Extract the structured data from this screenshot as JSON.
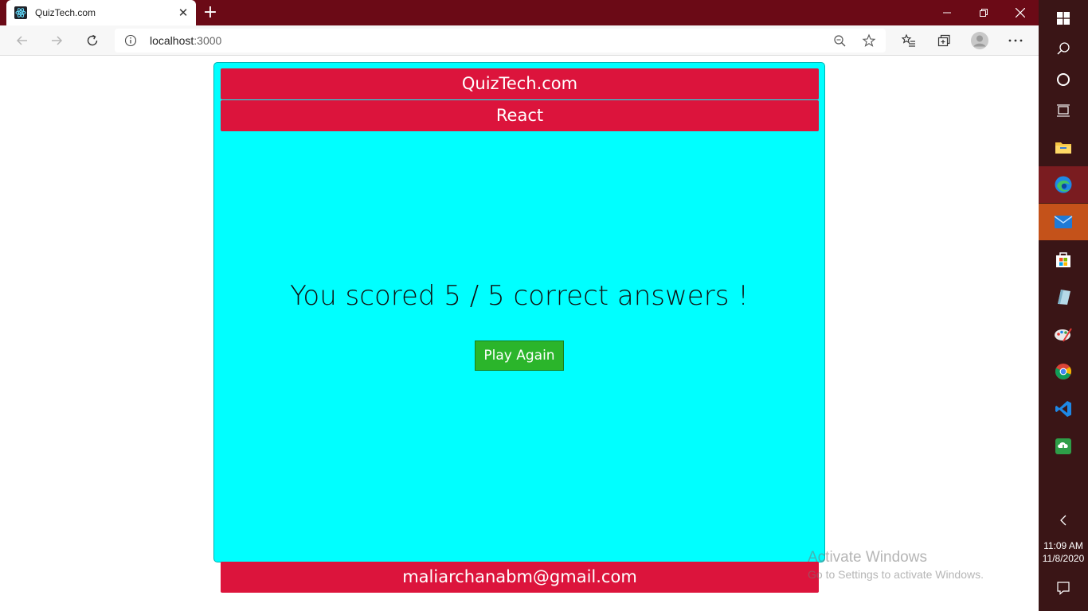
{
  "browser": {
    "tab_title": "QuizTech.com",
    "url_host": "localhost",
    "url_port": ":3000"
  },
  "quiz": {
    "site_title": "QuizTech.com",
    "category": "React",
    "score_text": "You scored 5 / 5 correct answers !",
    "play_again_label": "Play Again",
    "footer_email": "maliarchanabm@gmail.com"
  },
  "watermark": {
    "line1": "Activate Windows",
    "line2": "Go to Settings to activate Windows."
  },
  "taskbar": {
    "time": "11:09 AM",
    "date": "11/8/2020"
  },
  "colors": {
    "banner": "#dc143c",
    "card": "#00ffff",
    "button": "#2bb52b",
    "tabstrip": "#6b0a16"
  }
}
